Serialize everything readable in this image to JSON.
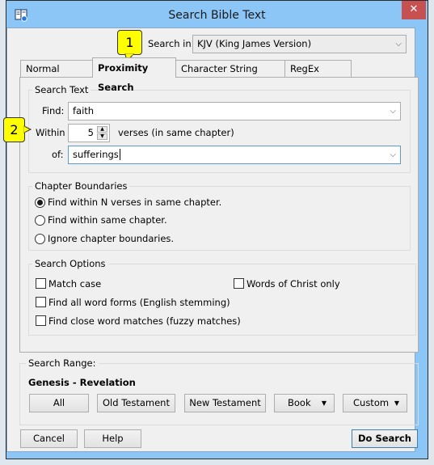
{
  "window": {
    "title": "Search Bible Text",
    "app_icon": "bible-search-icon",
    "close_label": "✕"
  },
  "callouts": [
    "1",
    "2"
  ],
  "search_in": {
    "label": "Search in:",
    "value": "KJV (King James Version)"
  },
  "tabs": [
    {
      "label": "Normal Search",
      "active": false
    },
    {
      "label": "Proximity Search",
      "active": true
    },
    {
      "label": "Character String Search",
      "active": false
    },
    {
      "label": "RegEx Search",
      "active": false
    }
  ],
  "search_text": {
    "group_label": "Search Text",
    "find_label": "Find:",
    "find_value": "faith",
    "within_label": "Within",
    "within_value": "5",
    "within_suffix": "verses (in same chapter)",
    "of_label": "of:",
    "of_value": "sufferings"
  },
  "chapter_boundaries": {
    "group_label": "Chapter Boundaries",
    "options": [
      {
        "label": "Find within N verses in same chapter.",
        "selected": true
      },
      {
        "label": "Find within same chapter.",
        "selected": false
      },
      {
        "label": "Ignore chapter boundaries.",
        "selected": false
      }
    ]
  },
  "search_options": {
    "group_label": "Search Options",
    "match_case": {
      "label": "Match case",
      "checked": false
    },
    "words_of_christ": {
      "label": "Words of Christ only",
      "checked": false
    },
    "word_forms": {
      "label": "Find all word forms (English stemming)",
      "checked": false
    },
    "fuzzy": {
      "label": "Find close word matches (fuzzy matches)",
      "checked": false
    }
  },
  "search_range": {
    "group_label": "Search Range:",
    "current": "Genesis - Revelation",
    "buttons": {
      "all": "All",
      "old_testament": "Old Testament",
      "new_testament": "New Testament",
      "book": "Book",
      "custom": "Custom"
    }
  },
  "footer": {
    "cancel": "Cancel",
    "help": "Help",
    "do_search": "Do Search"
  }
}
